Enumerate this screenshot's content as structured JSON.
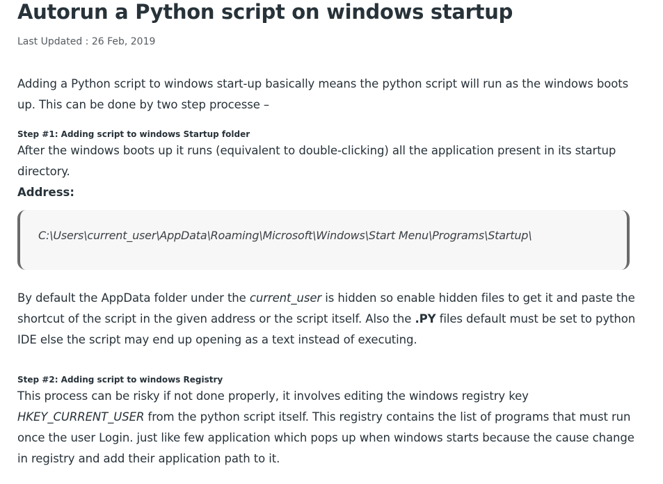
{
  "article": {
    "title": "Autorun a Python script on windows startup",
    "last_updated": "Last Updated : 26 Feb, 2019",
    "intro_line1": "Adding a Python script to windows start-up basically means the python script will run as the windows boots",
    "intro_line2": "up. This can be done by two step processe –",
    "step1": {
      "heading": "Step #1: Adding script to windows Startup folder",
      "text_line1": "After the windows boots up it runs (equivalent to double-clicking) all the application present in its startup",
      "text_line2": "directory.",
      "address_label": "Address:",
      "address_code": "C:\\Users\\current_user\\AppData\\Roaming\\Microsoft\\Windows\\Start Menu\\Programs\\Startup\\"
    },
    "note": {
      "l1_before": "By default the AppData folder under the ",
      "l1_em": "current_user",
      "l1_after": " is hidden so enable hidden files to get it and paste the",
      "l2_before": "shortcut of the script in the given address or the script itself. Also the ",
      "l2_strong": ".PY",
      "l2_after": " files default must be set to python",
      "l3": "IDE else the script may end up opening as a text instead of executing."
    },
    "step2": {
      "heading": "Step #2: Adding script to windows Registry",
      "text_line1": "This process can be risky if not done properly, it involves editing the windows registry key",
      "l2_em": "HKEY_CURRENT_USER",
      "l2_after": " from the python script itself. This registry contains the list of programs that must run",
      "text_line3": "once the user Login. just like few application which pops up when windows starts because the cause change",
      "text_line4": "in registry and add their application path to it."
    }
  }
}
